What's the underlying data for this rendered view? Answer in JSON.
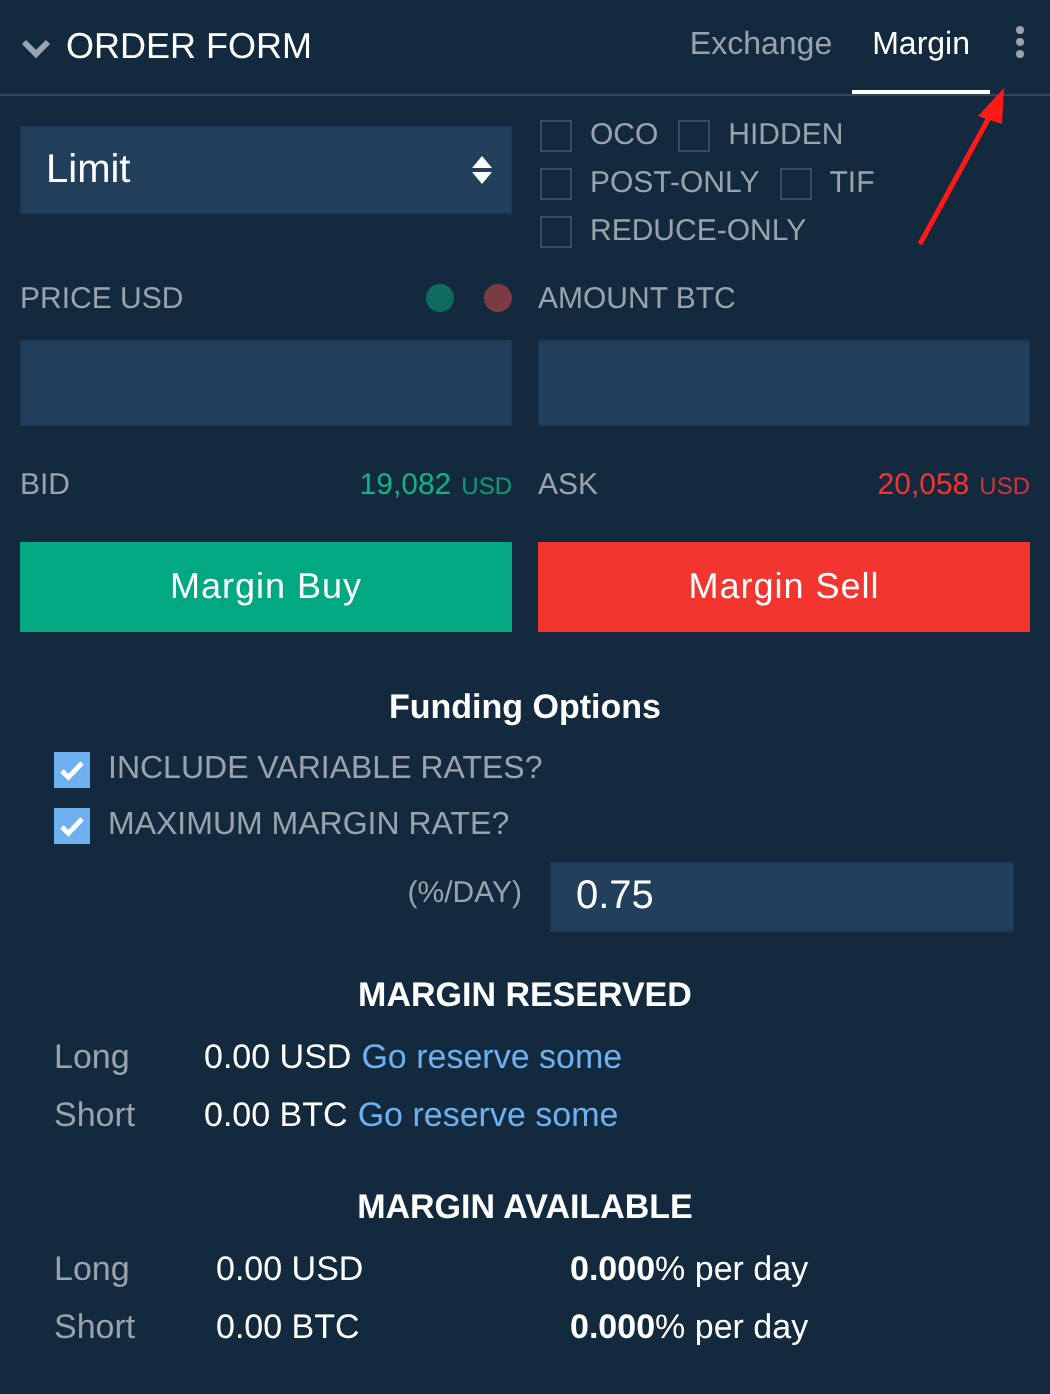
{
  "header": {
    "title": "ORDER FORM",
    "tabs": [
      {
        "label": "Exchange",
        "selected": false
      },
      {
        "label": "Margin",
        "selected": true
      }
    ]
  },
  "order_type": {
    "value": "Limit"
  },
  "flags": [
    {
      "label": "OCO",
      "checked": false
    },
    {
      "label": "HIDDEN",
      "checked": false
    },
    {
      "label": "POST-ONLY",
      "checked": false
    },
    {
      "label": "TIF",
      "checked": false
    },
    {
      "label": "REDUCE-ONLY",
      "checked": false
    }
  ],
  "price": {
    "label": "PRICE USD",
    "dots": [
      {
        "color": "#0f6b5f"
      },
      {
        "color": "#7a3b42"
      }
    ]
  },
  "amount": {
    "label": "AMOUNT BTC"
  },
  "bid": {
    "label": "BID",
    "value": "19,082",
    "unit": "USD"
  },
  "ask": {
    "label": "ASK",
    "value": "20,058",
    "unit": "USD"
  },
  "buttons": [
    {
      "label": "Margin Buy",
      "kind": "buy"
    },
    {
      "label": "Margin Sell",
      "kind": "sell"
    }
  ],
  "funding": {
    "title": "Funding Options",
    "options": [
      {
        "label": "INCLUDE VARIABLE RATES?",
        "checked": true
      },
      {
        "label": "MAXIMUM MARGIN RATE?",
        "checked": true
      }
    ],
    "rate_label": "(%/DAY)",
    "rate_value": "0.75"
  },
  "reserved": {
    "title": "MARGIN RESERVED",
    "rows": [
      {
        "side": "Long",
        "amount": "0.00 USD",
        "link": "Go reserve some"
      },
      {
        "side": "Short",
        "amount": "0.00 BTC",
        "link": "Go reserve some"
      }
    ]
  },
  "available": {
    "title": "MARGIN AVAILABLE",
    "rows": [
      {
        "side": "Long",
        "amount": "0.00 USD",
        "rate": "**0.000**% per day"
      },
      {
        "side": "Short",
        "amount": "0.00 BTC",
        "rate": "**0.000**% per day"
      }
    ]
  }
}
